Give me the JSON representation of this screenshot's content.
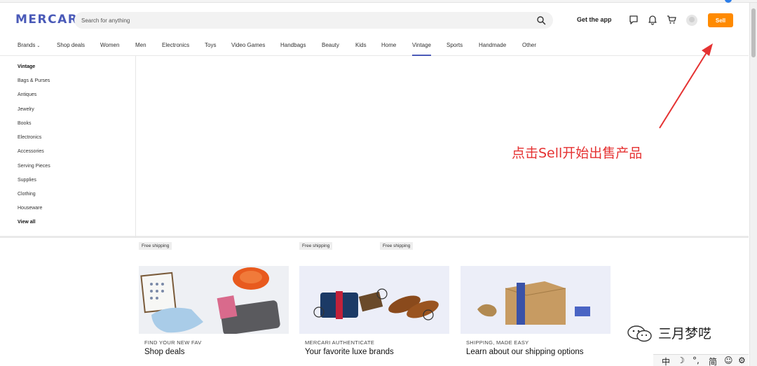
{
  "header": {
    "logo": "MERCARI",
    "search_placeholder": "Search for anything",
    "get_app": "Get the app",
    "sell": "Sell",
    "icons": [
      "message-icon",
      "bell-icon",
      "cart-icon",
      "avatar"
    ]
  },
  "categories": [
    {
      "label": "Brands",
      "has_chevron": true
    },
    {
      "label": "Shop deals"
    },
    {
      "label": "Women"
    },
    {
      "label": "Men"
    },
    {
      "label": "Electronics"
    },
    {
      "label": "Toys"
    },
    {
      "label": "Video Games"
    },
    {
      "label": "Handbags"
    },
    {
      "label": "Beauty"
    },
    {
      "label": "Kids"
    },
    {
      "label": "Home"
    },
    {
      "label": "Vintage",
      "active": true
    },
    {
      "label": "Sports"
    },
    {
      "label": "Handmade"
    },
    {
      "label": "Other"
    }
  ],
  "dropdown": {
    "heading": "Vintage",
    "items": [
      "Bags & Purses",
      "Antiques",
      "Jewelry",
      "Books",
      "Electronics",
      "Accessories",
      "Serving Pieces",
      "Supplies",
      "Clothing",
      "Houseware"
    ],
    "view_all": "View all"
  },
  "annotation": "点击Sell开始出售产品",
  "shipping_tags": [
    "Free shipping",
    "Free shipping",
    "Free shipping"
  ],
  "cards": [
    {
      "eyebrow": "FIND YOUR NEW FAV",
      "title": "Shop deals"
    },
    {
      "eyebrow": "MERCARI AUTHENTICATE",
      "title": "Your favorite luxe brands"
    },
    {
      "eyebrow": "SHIPPING, MADE EASY",
      "title": "Learn about our shipping options"
    }
  ],
  "watermark": "三月梦呓",
  "ime": {
    "items": [
      "中",
      "☽",
      "°,",
      "简",
      "☺",
      "⚙"
    ]
  },
  "colors": {
    "brand": "#4a5ab8",
    "sell": "#ff8a00",
    "annotation": "#e53232"
  }
}
